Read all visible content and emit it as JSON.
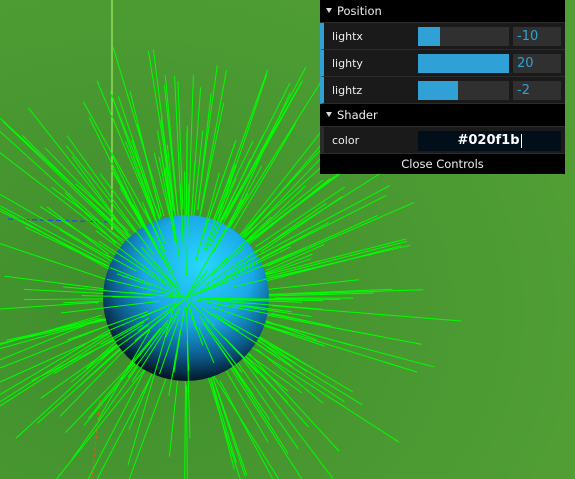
{
  "gui": {
    "folders": [
      {
        "title": "Position",
        "controllers": [
          {
            "label": "lightx",
            "value": "-10",
            "fill": 0.24
          },
          {
            "label": "lighty",
            "value": "20",
            "fill": 1.0
          },
          {
            "label": "lightz",
            "value": "-2",
            "fill": 0.44
          }
        ]
      },
      {
        "title": "Shader",
        "controllers": [
          {
            "label": "color",
            "value": "#020f1b"
          }
        ]
      }
    ],
    "close_label": "Close Controls"
  },
  "scene": {
    "background_color": "#4d9a33",
    "sphere_color": "#1ec8ff",
    "normals_color": "#00ff00"
  }
}
